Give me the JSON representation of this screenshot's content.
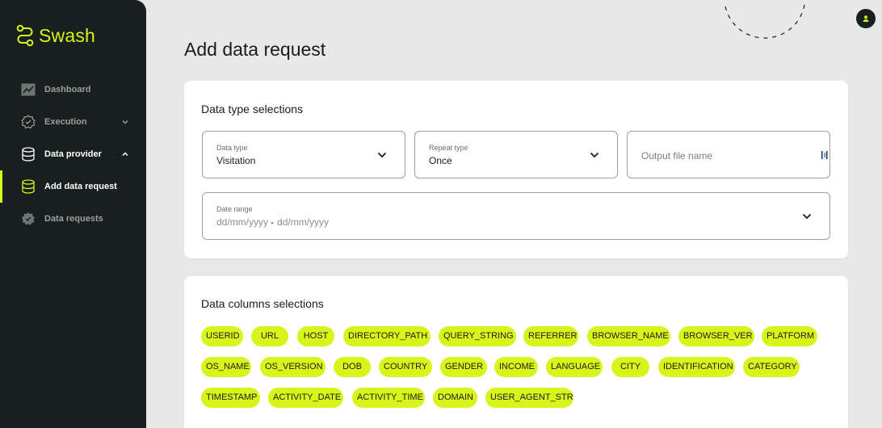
{
  "app": {
    "logo_text": "Swash",
    "brand_color": "#d9f41b",
    "sidebar_bg": "#17201e"
  },
  "sidebar": {
    "items": [
      {
        "label": "Dashboard",
        "icon": "chart-icon"
      },
      {
        "label": "Execution",
        "icon": "gear-check-icon",
        "chevron": "down"
      },
      {
        "label": "Data provider",
        "icon": "database-icon",
        "chevron": "up"
      },
      {
        "label": "Add data request",
        "icon": "database-add-icon"
      },
      {
        "label": "Data requests",
        "icon": "shield-check-icon"
      }
    ]
  },
  "header": {
    "avatar_icon": "user-icon"
  },
  "page": {
    "title": "Add data request"
  },
  "data_type_card": {
    "title": "Data type selections",
    "data_type": {
      "label": "Data type",
      "value": "Visitation"
    },
    "repeat_type": {
      "label": "Repeat type",
      "value": "Once"
    },
    "output_file": {
      "placeholder": "Output file name"
    },
    "date_range": {
      "label": "Date range",
      "start_placeholder": "dd/mm/yyyy",
      "separator": "-",
      "end_placeholder": "dd/mm/yyyy"
    }
  },
  "columns_card": {
    "title": "Data columns selections",
    "rows": [
      [
        "USERID",
        "URL",
        "HOST",
        "DIRECTORY_PATH",
        "QUERY_STRING",
        "REFERRER",
        "BROWSER_NAME",
        "BROWSER_VER",
        "PLATFORM"
      ],
      [
        "OS_NAME",
        "OS_VERSION",
        "DOB",
        "COUNTRY",
        "GENDER",
        "INCOME",
        "LANGUAGE",
        "CITY",
        "IDENTIFICATION",
        "CATEGORY"
      ],
      [
        "TIMESTAMP",
        "ACTIVITY_DATE",
        "ACTIVITY_TIME",
        "DOMAIN",
        "USER_AGENT_STR"
      ]
    ]
  }
}
